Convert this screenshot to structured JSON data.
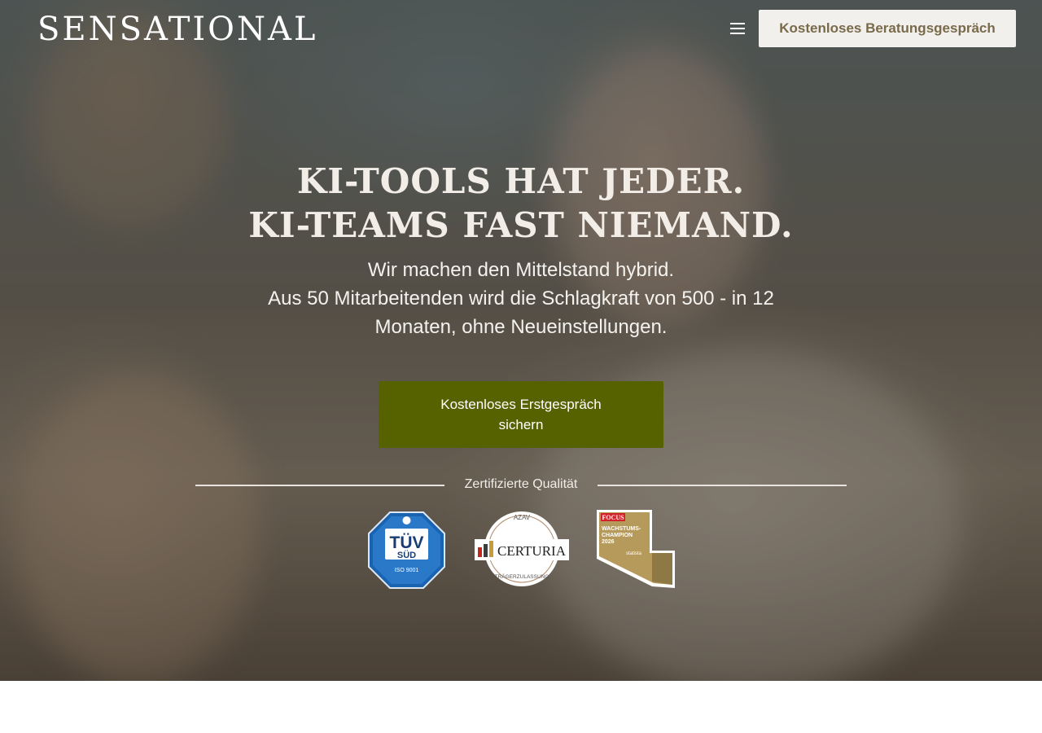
{
  "header": {
    "logo_text": "SENSATIONAL",
    "cta_label": "Kostenloses Beratungsgespräch",
    "menu_icon": "menu-icon"
  },
  "hero": {
    "headline_line1": "KI-TOOLS HAT JEDER.",
    "headline_line2": "KI-TEAMS FAST NIEMAND.",
    "subline_line1": "Wir machen den Mittelstand hybrid.",
    "subline_line2": "Aus 50 Mitarbeitenden wird die Schlagkraft von 500 - in 12 Monaten, ohne Neueinstellungen.",
    "cta_label": "Kostenloses Erstgespräch sichern"
  },
  "certifications": {
    "title": "Zertifizierte Qualität",
    "badges": [
      {
        "name": "tuv-sud-badge",
        "top": "TÜV",
        "bottom": "SÜD",
        "code": "ISO 9001"
      },
      {
        "name": "certuria-badge",
        "top": "AZAV",
        "label": "CERTURIA",
        "bottom": "TRÄGERZULASSUNG"
      },
      {
        "name": "focus-wachstumschampion-badge",
        "brand": "FOCUS",
        "label1": "WACHSTUMS-",
        "label2": "CHAMPION",
        "year": "2026",
        "partner": "statista"
      }
    ]
  },
  "colors": {
    "cta_green": "#566200",
    "header_button_bg": "#f1f0ec",
    "header_button_text": "#7a6a4c",
    "tuv_blue": "#1a63b0"
  }
}
